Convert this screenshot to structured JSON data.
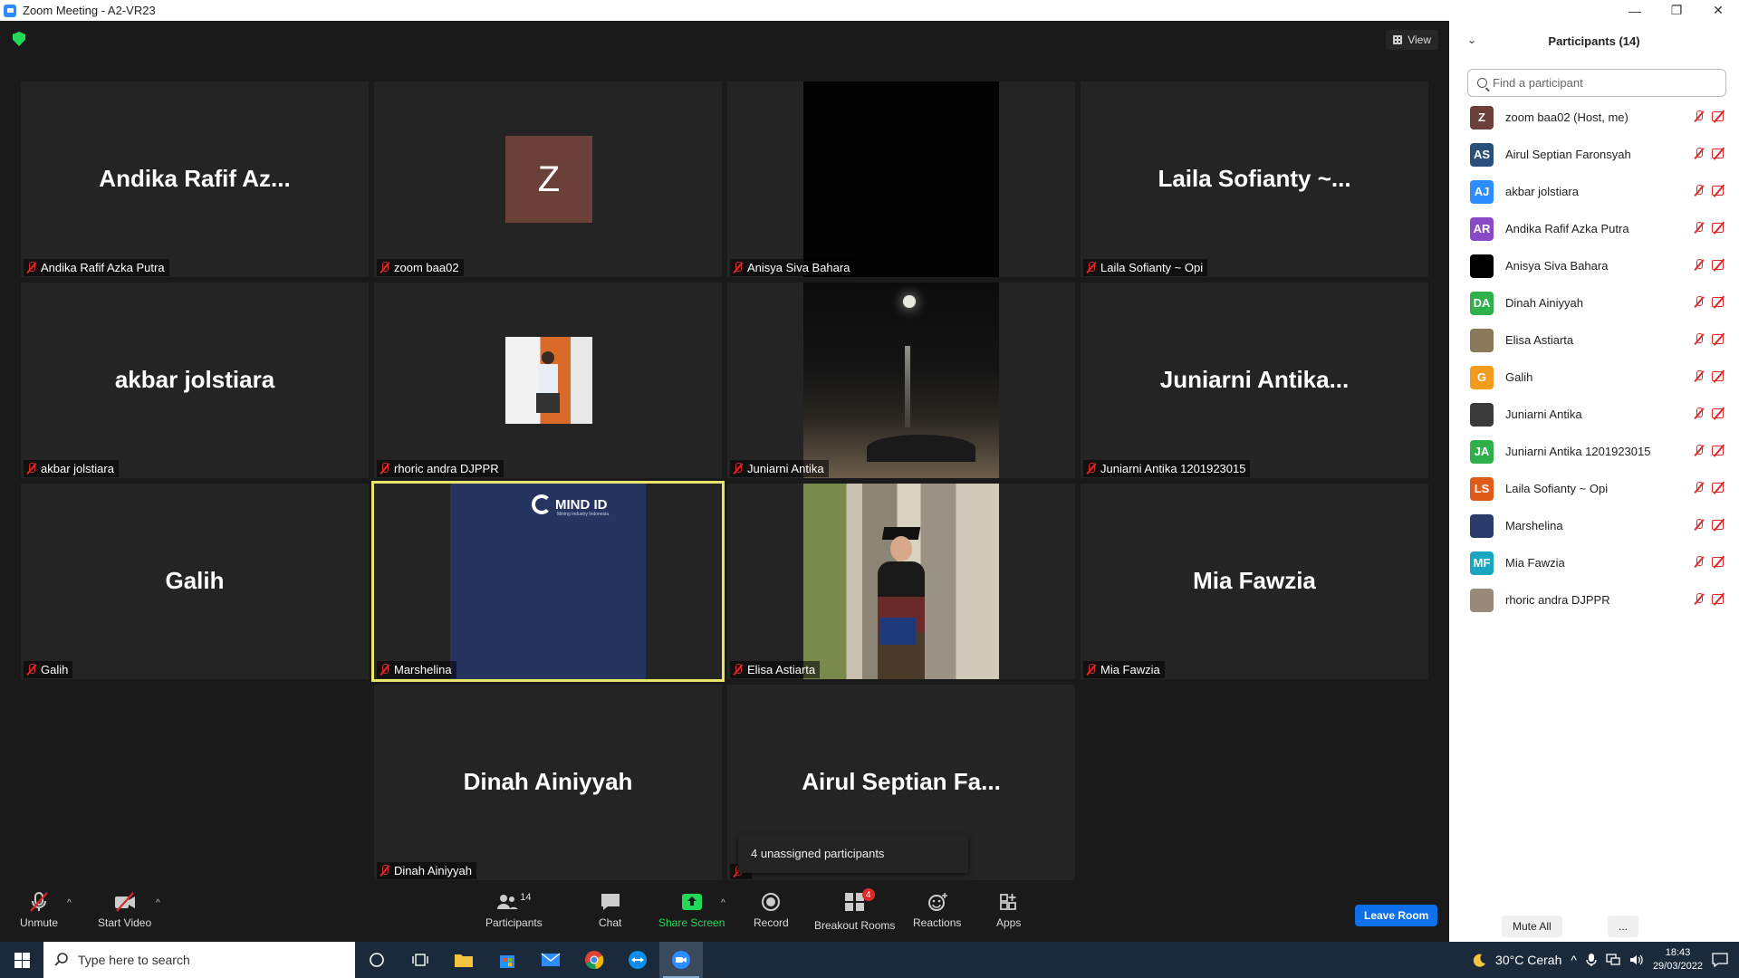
{
  "window": {
    "title": "Zoom Meeting - A2-VR23",
    "min": "—",
    "max": "❐",
    "close": "✕"
  },
  "view_label": "View",
  "tiles": {
    "t1": {
      "big": "Andika Rafif Az...",
      "name": "Andika Rafif Azka Putra"
    },
    "t2": {
      "avatar": "Z",
      "name": "zoom baa02"
    },
    "t3": {
      "name": "Anisya Siva Bahara"
    },
    "t4": {
      "big": "Laila Sofianty ~...",
      "name": "Laila Sofianty ~ Opi"
    },
    "t5": {
      "big": "akbar jolstiara",
      "name": "akbar jolstiara"
    },
    "t6": {
      "name": "rhoric andra DJPPR"
    },
    "t7": {
      "name": "Juniarni Antika"
    },
    "t8": {
      "big": "Juniarni  Antika...",
      "name": "Juniarni Antika 1201923015"
    },
    "t9": {
      "big": "Galih",
      "name": "Galih"
    },
    "t10": {
      "name": "Marshelina",
      "logo": "MIND ID",
      "logo_sub": "Mining Industry Indonesia"
    },
    "t11": {
      "name": "Elisa Astiarta"
    },
    "t12": {
      "big": "Mia Fawzia",
      "name": "Mia Fawzia"
    },
    "t13": {
      "big": "Dinah Ainiyyah",
      "name": "Dinah Ainiyyah"
    },
    "t14": {
      "big": "Airul Septian Fa...",
      "name": ""
    }
  },
  "popup": "4 unassigned participants",
  "toolbar": {
    "unmute": "Unmute",
    "start_video": "Start Video",
    "participants": "Participants",
    "participants_count": "14",
    "chat": "Chat",
    "share": "Share Screen",
    "record": "Record",
    "breakout": "Breakout Rooms",
    "breakout_badge": "4",
    "reactions": "Reactions",
    "apps": "Apps",
    "leave": "Leave Room"
  },
  "panel": {
    "title": "Participants (14)",
    "search_placeholder": "Find a participant",
    "participants": [
      {
        "initials": "Z",
        "name": "zoom baa02 (Host, me)",
        "color": "#6b4038"
      },
      {
        "initials": "AS",
        "name": "Airul Septian Faronsyah",
        "color": "#2a4f7a"
      },
      {
        "initials": "AJ",
        "name": "akbar jolstiara",
        "color": "#2d8cff"
      },
      {
        "initials": "AR",
        "name": "Andika Rafif Azka Putra",
        "color": "#8a4ac7"
      },
      {
        "initials": "",
        "name": "Anisya Siva Bahara",
        "color": "#000000"
      },
      {
        "initials": "DA",
        "name": "Dinah Ainiyyah",
        "color": "#2fb04a"
      },
      {
        "initials": "",
        "name": "Elisa Astiarta",
        "color": "#8a7a5a"
      },
      {
        "initials": "G",
        "name": "Galih",
        "color": "#f29b1d"
      },
      {
        "initials": "",
        "name": "Juniarni Antika",
        "color": "#3a3a3a"
      },
      {
        "initials": "JA",
        "name": "Juniarni Antika 1201923015",
        "color": "#2fb04a"
      },
      {
        "initials": "LS",
        "name": "Laila Sofianty ~ Opi",
        "color": "#e05a1a"
      },
      {
        "initials": "",
        "name": "Marshelina",
        "color": "#2a3a6a"
      },
      {
        "initials": "MF",
        "name": "Mia Fawzia",
        "color": "#1aa5c0"
      },
      {
        "initials": "",
        "name": "rhoric andra DJPPR",
        "color": "#9a8a7a"
      }
    ],
    "mute_all": "Mute All",
    "more": "..."
  },
  "taskbar": {
    "search_placeholder": "Type here to search",
    "weather": "30°C  Cerah",
    "time": "18:43",
    "date": "29/03/2022"
  }
}
